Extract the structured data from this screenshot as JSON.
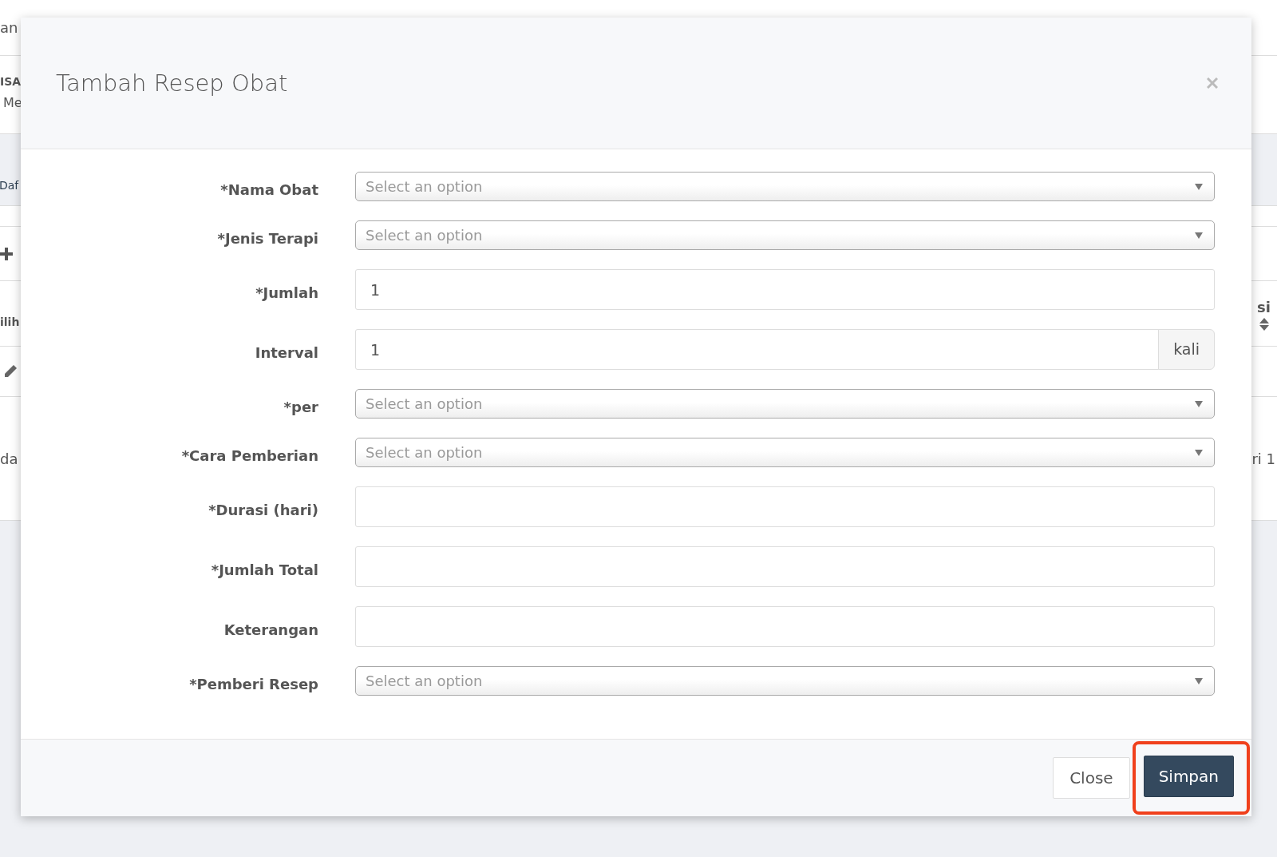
{
  "background": {
    "top_text": "an",
    "brand": "ISA",
    "brand_sub": "Me",
    "tab": "Daf",
    "header_left": "ilih",
    "header_right": "si",
    "cell_left": "da",
    "cell_right": "ri 1"
  },
  "modal": {
    "title": "Tambah Resep Obat",
    "fields": [
      {
        "kind": "select",
        "label": "*Nama Obat",
        "placeholder": "Select an option"
      },
      {
        "kind": "select",
        "label": "*Jenis Terapi",
        "placeholder": "Select an option"
      },
      {
        "kind": "input",
        "label": "*Jumlah",
        "value": "1"
      },
      {
        "kind": "input-group",
        "label": "Interval",
        "value": "1",
        "addon": "kali"
      },
      {
        "kind": "select",
        "label": "*per",
        "placeholder": "Select an option"
      },
      {
        "kind": "select",
        "label": "*Cara Pemberian",
        "placeholder": "Select an option"
      },
      {
        "kind": "input",
        "label": "*Durasi (hari)"
      },
      {
        "kind": "input",
        "label": "*Jumlah Total"
      },
      {
        "kind": "input",
        "label": "Keterangan"
      },
      {
        "kind": "select",
        "label": "*Pemberi Resep",
        "placeholder": "Select an option"
      }
    ],
    "buttons": [
      {
        "kind": "default",
        "label": "Close",
        "highlighted": false
      },
      {
        "kind": "primary",
        "label": "Simpan",
        "highlighted": true
      }
    ]
  }
}
